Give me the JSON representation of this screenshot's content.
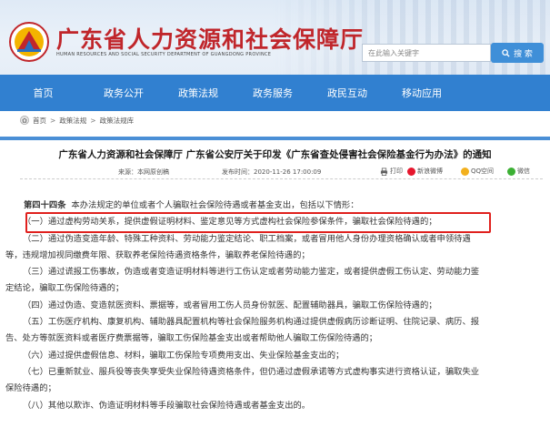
{
  "header": {
    "site_title": "广东省人力资源和社会保障厅",
    "site_subtitle": "HUMAN RESOURCES AND SOCIAL SECURITY DEPARTMENT OF GUANGDONG PROVINCE",
    "search_placeholder": "在此输入关键字",
    "search_button": "搜 索",
    "brand_color": "#c0262b",
    "nav_color": "#3180d0"
  },
  "nav": {
    "items": [
      {
        "label": "首页"
      },
      {
        "label": "政务公开"
      },
      {
        "label": "政策法规"
      },
      {
        "label": "政务服务"
      },
      {
        "label": "政民互动"
      },
      {
        "label": "移动应用"
      }
    ]
  },
  "breadcrumb": {
    "items": [
      "首页",
      "政策法规",
      "政策法规库"
    ],
    "separator": ">"
  },
  "article": {
    "title": "广东省人力资源和社会保障厅 广东省公安厅关于印发《广东省查处侵害社会保险基金行为办法》的通知",
    "source": "来源：本网原创稿",
    "time": "发布时间：2020-11-26 17:00:09",
    "print_label": "打印",
    "share": {
      "weibo": "新浪微博",
      "qq": "QQ空间",
      "wechat": "微信"
    },
    "article_no": "第四十四条",
    "lines": [
      "本办法规定的单位或者个人骗取社会保险待遇或者基金支出，包括以下情形：",
      "（一）通过虚构劳动关系，提供虚假证明材料、鉴定意见等方式虚构社会保险参保条件，骗取社会保险待遇的；",
      "（二）通过伪造变造年龄、特殊工种资料、劳动能力鉴定结论、职工档案，或者冒用他人身份办理资格确认或者申领待遇",
      "等，违规增加视同缴费年限、获取养老保险待遇资格条件，骗取养老保险待遇的；",
      "（三）通过谎报工伤事故，伪造或者变造证明材料等进行工伤认定或者劳动能力鉴定，或者提供虚假工伤认定、劳动能力鉴",
      "定结论，骗取工伤保险待遇的；",
      "（四）通过伪造、变造就医资料、票据等，或者冒用工伤人员身份就医、配置辅助器具，骗取工伤保险待遇的；",
      "（五）工伤医疗机构、康复机构、辅助器具配置机构等社会保险服务机构通过提供虚假病历诊断证明、住院记录、病历、报",
      "告、处方等就医资料或者医疗费票据等，骗取工伤保险基金支出或者帮助他人骗取工伤保险待遇的；",
      "（六）通过提供虚假信息、材料，骗取工伤保险专项费用支出、失业保险基金支出的；",
      "（七）已重新就业、服兵役等丧失享受失业保险待遇资格条件，但仍通过虚假承诺等方式虚构事实进行资格认证，骗取失业",
      "保险待遇的；",
      "（八）其他以欺诈、伪造证明材料等手段骗取社会保险待遇或者基金支出的。"
    ],
    "highlight_color": "#e0201d"
  }
}
